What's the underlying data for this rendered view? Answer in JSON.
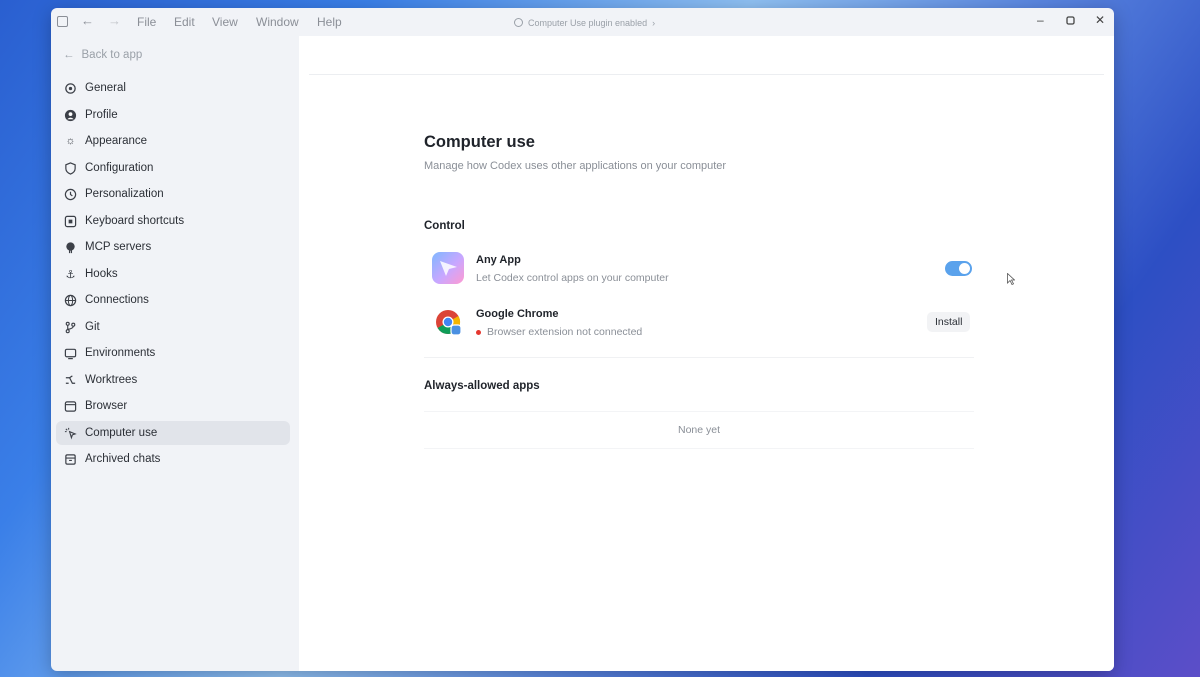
{
  "titlebar": {
    "menus": [
      "File",
      "Edit",
      "View",
      "Window",
      "Help"
    ],
    "plugin_status": "Computer Use plugin enabled",
    "plugin_chevron": "›"
  },
  "sidebar": {
    "back_label": "Back to app",
    "items": [
      {
        "label": "General",
        "icon": "gear-icon"
      },
      {
        "label": "Profile",
        "icon": "profile-icon"
      },
      {
        "label": "Appearance",
        "icon": "sun-icon"
      },
      {
        "label": "Configuration",
        "icon": "shield-icon"
      },
      {
        "label": "Personalization",
        "icon": "personalization-icon"
      },
      {
        "label": "Keyboard shortcuts",
        "icon": "keyboard-icon"
      },
      {
        "label": "MCP servers",
        "icon": "mcp-icon"
      },
      {
        "label": "Hooks",
        "icon": "anchor-icon"
      },
      {
        "label": "Connections",
        "icon": "globe-icon"
      },
      {
        "label": "Git",
        "icon": "git-branch-icon"
      },
      {
        "label": "Environments",
        "icon": "monitor-icon"
      },
      {
        "label": "Worktrees",
        "icon": "worktree-icon"
      },
      {
        "label": "Browser",
        "icon": "browser-icon"
      },
      {
        "label": "Computer use",
        "icon": "computer-use-icon",
        "active": true
      },
      {
        "label": "Archived chats",
        "icon": "archive-icon"
      }
    ]
  },
  "main": {
    "title": "Computer use",
    "subtitle": "Manage how Codex uses other applications on your computer",
    "control_section": "Control",
    "apps": [
      {
        "name": "Any App",
        "description": "Let Codex control apps on your computer",
        "toggle_on": true
      },
      {
        "name": "Google Chrome",
        "description": "Browser extension not connected",
        "action": "Install",
        "status_color": "#e5372f"
      }
    ],
    "always_allowed_section": "Always-allowed apps",
    "always_allowed_empty": "None yet"
  },
  "colors": {
    "accent": "#5aa2ec",
    "sidebar_bg": "#f1f3f7",
    "active_item_bg": "#e1e4ea"
  }
}
